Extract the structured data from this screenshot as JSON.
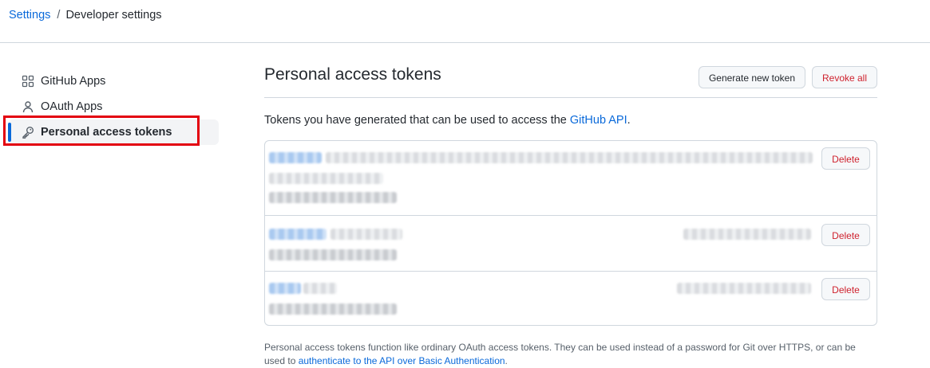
{
  "breadcrumb": {
    "settings": "Settings",
    "separator": "/",
    "current": "Developer settings"
  },
  "sidebar": {
    "items": [
      {
        "label": "GitHub Apps",
        "icon": "apps-grid-icon",
        "active": false
      },
      {
        "label": "OAuth Apps",
        "icon": "person-icon",
        "active": false
      },
      {
        "label": "Personal access tokens",
        "icon": "key-icon",
        "active": true
      }
    ]
  },
  "main": {
    "title": "Personal access tokens",
    "generate_label": "Generate new token",
    "revoke_label": "Revoke all",
    "intro_text": "Tokens you have generated that can be used to access the ",
    "intro_link": "GitHub API",
    "intro_end": ".",
    "delete_label": "Delete",
    "footer_text": "Personal access tokens function like ordinary OAuth access tokens. They can be used instead of a password for Git over HTTPS, or can be used to ",
    "footer_link": "authenticate to the API over Basic Authentication",
    "footer_end": "."
  },
  "colors": {
    "accent": "#0969da",
    "danger": "#cf222e",
    "highlight_box": "#e3000f"
  }
}
